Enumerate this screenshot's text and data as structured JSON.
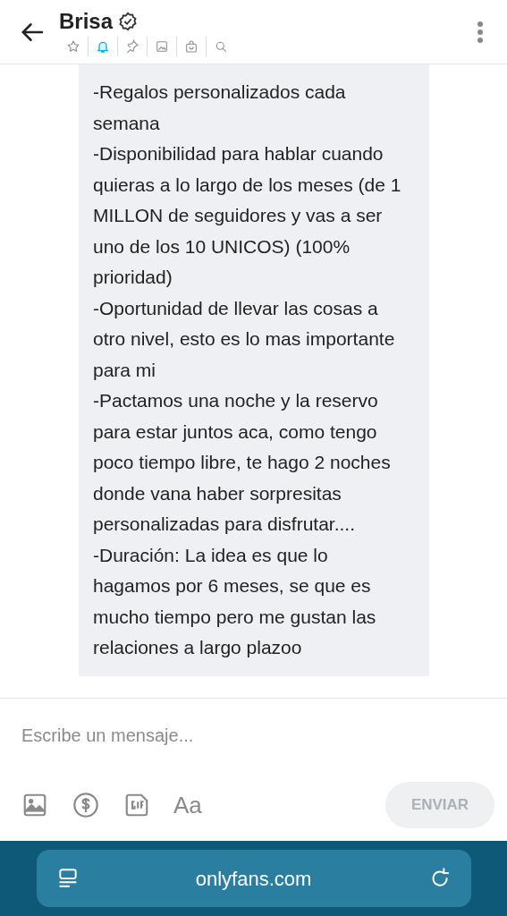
{
  "header": {
    "name": "Brisa",
    "verified": true,
    "tabs": [
      {
        "kind": "star",
        "selected": false
      },
      {
        "kind": "bell",
        "selected": true
      },
      {
        "kind": "pin",
        "selected": false
      },
      {
        "kind": "image",
        "selected": false
      },
      {
        "kind": "bag",
        "selected": false
      },
      {
        "kind": "search",
        "selected": false
      }
    ]
  },
  "message": {
    "paragraphs": [
      "-Regalos personalizados cada semana",
      "-Disponibilidad para hablar cuando quieras a lo largo de los meses (de 1 MILLON de seguidores y vas a ser uno de los 10 UNICOS) (100% prioridad)",
      "-Oportunidad de llevar las cosas a otro nivel, esto es lo mas importante para mi",
      "-Pactamos una noche y la reservo para estar juntos aca, como tengo poco tiempo libre, te hago 2 noches donde vana haber sorpresitas personalizadas para disfrutar....",
      "-Duración: La idea es que lo hagamos por 6 meses, se que es mucho tiempo pero me gustan las relaciones a largo plazoo"
    ]
  },
  "composer": {
    "placeholder": "Escribe un mensaje...",
    "tools": [
      {
        "kind": "image"
      },
      {
        "kind": "dollar"
      },
      {
        "kind": "gif"
      },
      {
        "kind": "text",
        "label": "Aa"
      }
    ],
    "send": {
      "label": "ENVIAR",
      "disabled": true
    }
  },
  "browser": {
    "url": "onlyfans.com"
  }
}
